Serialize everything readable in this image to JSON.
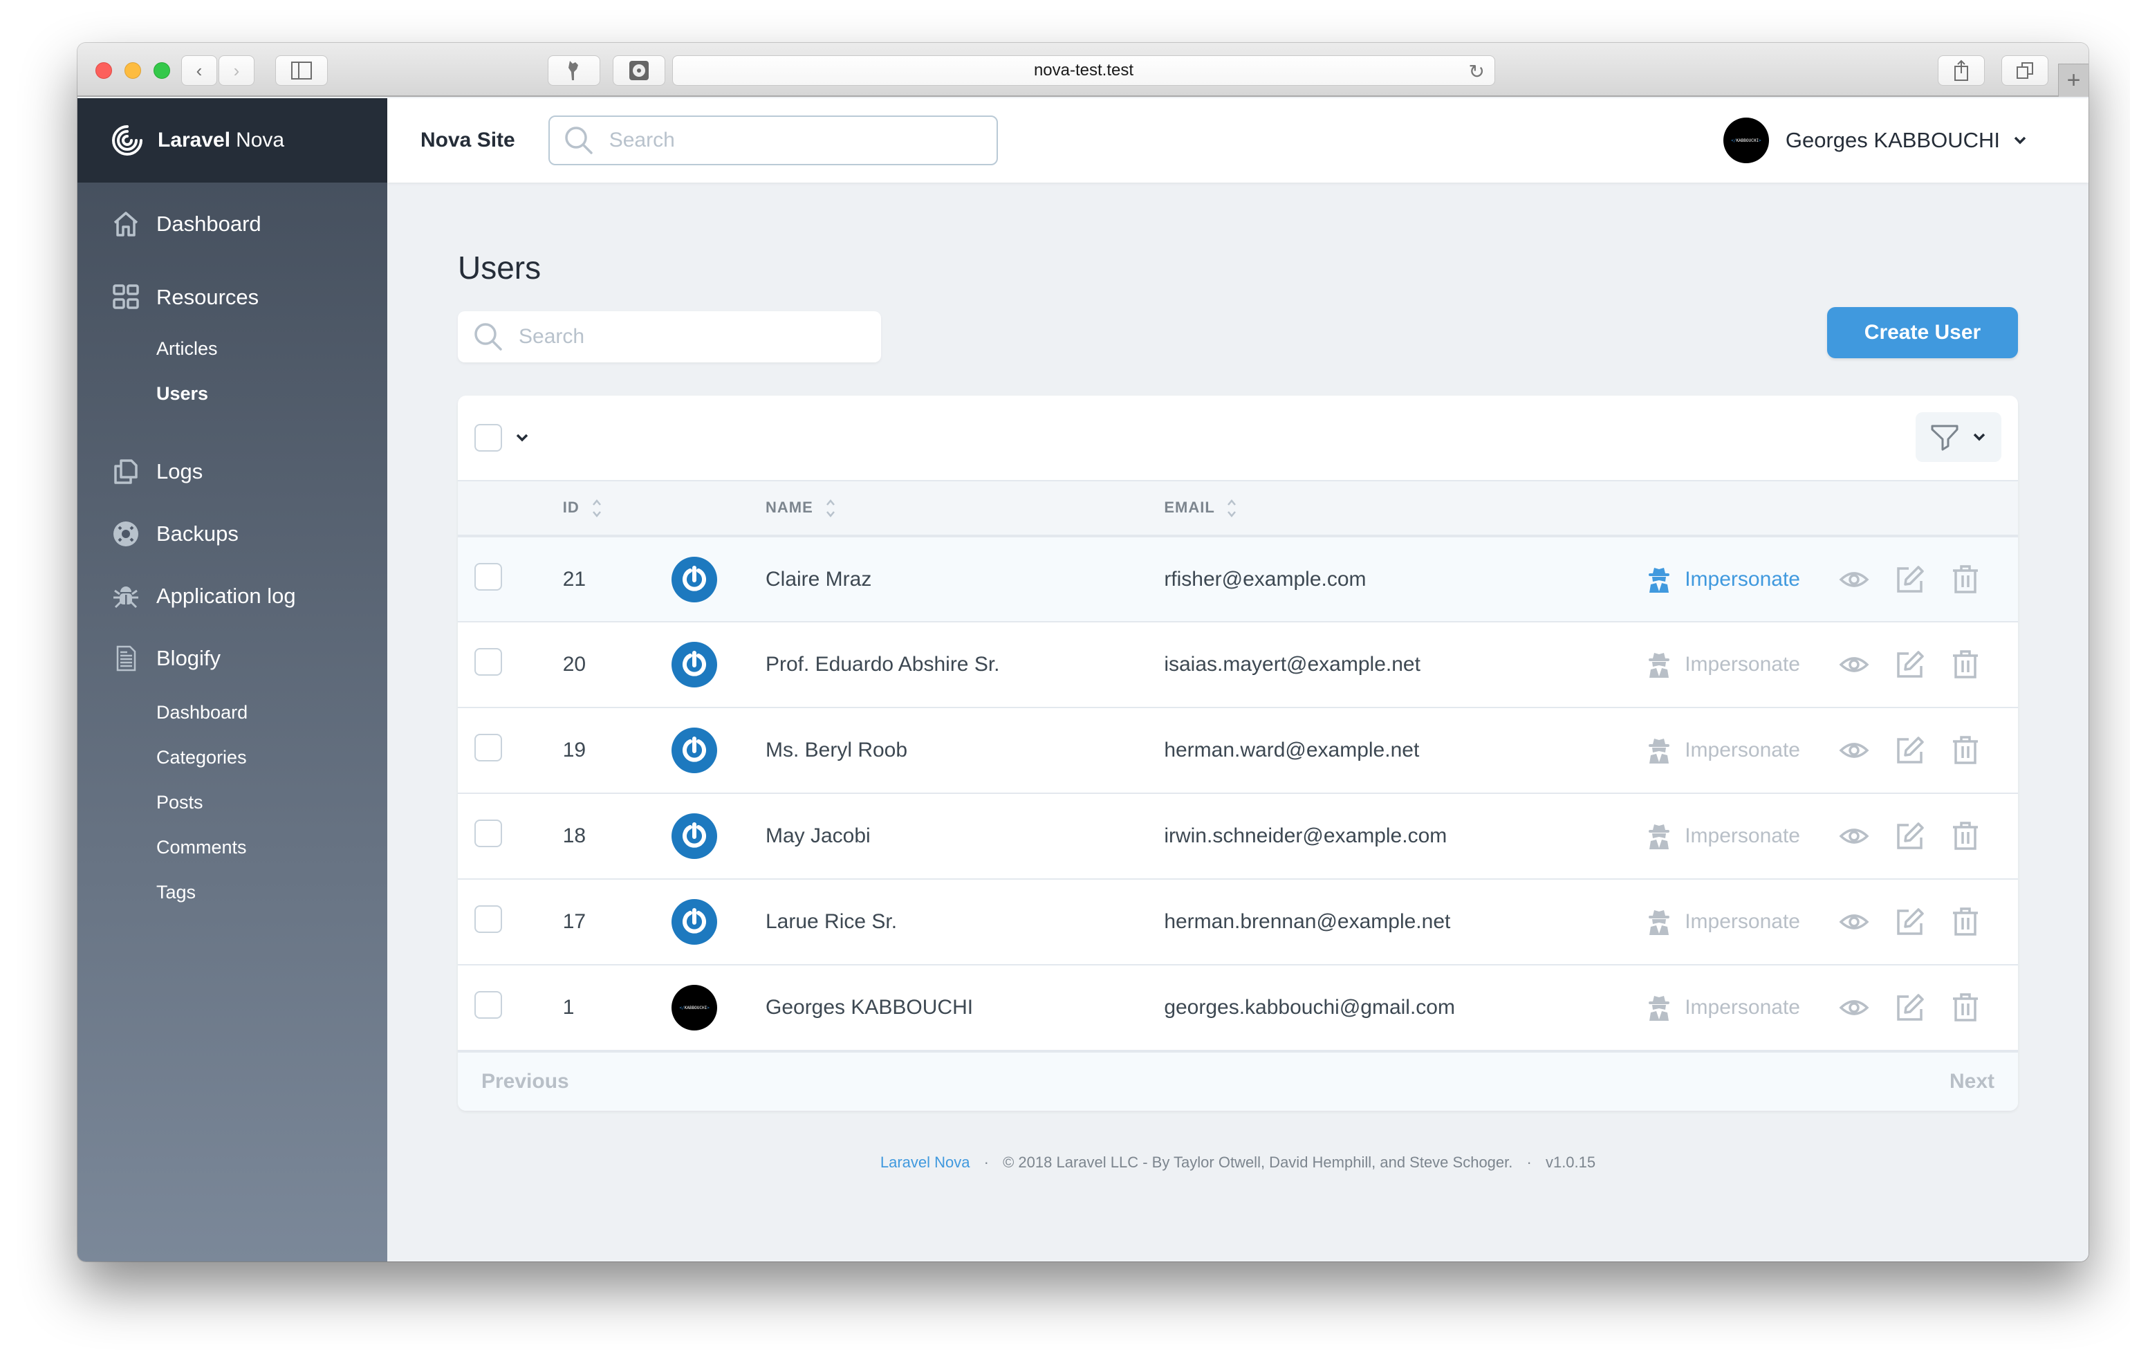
{
  "browser": {
    "url": "nova-test.test"
  },
  "sidebar": {
    "brand_bold": "Laravel",
    "brand_light": "Nova",
    "items": [
      {
        "label": "Dashboard",
        "icon": "home-icon"
      },
      {
        "label": "Resources",
        "icon": "grid-icon",
        "children": [
          {
            "label": "Articles",
            "active": false
          },
          {
            "label": "Users",
            "active": true
          }
        ]
      },
      {
        "label": "Logs",
        "icon": "documents-icon"
      },
      {
        "label": "Backups",
        "icon": "lifebuoy-icon"
      },
      {
        "label": "Application log",
        "icon": "bug-icon"
      },
      {
        "label": "Blogify",
        "icon": "document-icon",
        "children": [
          {
            "label": "Dashboard"
          },
          {
            "label": "Categories"
          },
          {
            "label": "Posts"
          },
          {
            "label": "Comments"
          },
          {
            "label": "Tags"
          }
        ]
      }
    ]
  },
  "header": {
    "site_title": "Nova Site",
    "search_placeholder": "Search",
    "user_name": "Georges KABBOUCHI",
    "avatar_text": "KABBOUCHI"
  },
  "page": {
    "title": "Users",
    "search_placeholder": "Search",
    "create_button": "Create User"
  },
  "table": {
    "columns": [
      "ID",
      "NAME",
      "EMAIL"
    ],
    "impersonate_label": "Impersonate",
    "rows": [
      {
        "id": "21",
        "name": "Claire Mraz",
        "email": "rfisher@example.com",
        "avatar": "nova",
        "hovered": true
      },
      {
        "id": "20",
        "name": "Prof. Eduardo Abshire Sr.",
        "email": "isaias.mayert@example.net",
        "avatar": "nova",
        "hovered": false
      },
      {
        "id": "19",
        "name": "Ms. Beryl Roob",
        "email": "herman.ward@example.net",
        "avatar": "nova",
        "hovered": false
      },
      {
        "id": "18",
        "name": "May Jacobi",
        "email": "irwin.schneider@example.com",
        "avatar": "nova",
        "hovered": false
      },
      {
        "id": "17",
        "name": "Larue Rice Sr.",
        "email": "herman.brennan@example.net",
        "avatar": "nova",
        "hovered": false
      },
      {
        "id": "1",
        "name": "Georges KABBOUCHI",
        "email": "georges.kabbouchi@gmail.com",
        "avatar": "kabbouchi",
        "hovered": false
      }
    ],
    "previous_label": "Previous",
    "next_label": "Next"
  },
  "footer": {
    "brand": "Laravel Nova",
    "copyright": "© 2018 Laravel LLC - By Taylor Otwell, David Hemphill, and Steve Schoger.",
    "version": "v1.0.15"
  },
  "colors": {
    "accent": "#4099de",
    "sidebar_brand_bg": "#252d38",
    "avatar_blue": "#1d79bf"
  }
}
